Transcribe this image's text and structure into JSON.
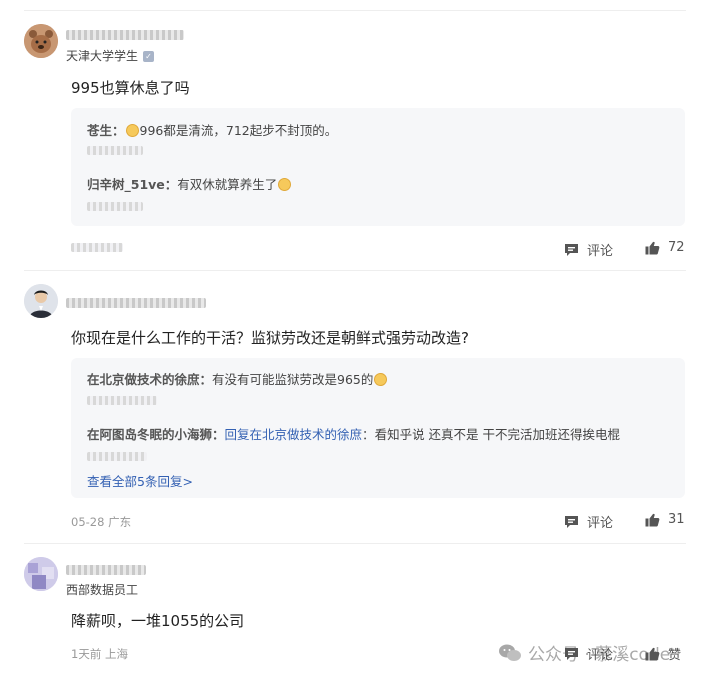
{
  "comments": [
    {
      "badge": "天津大学学生",
      "content": "995也算休息了吗",
      "replies": [
        {
          "name": "苍生",
          "text": "996都是清流，712起步不封顶的。"
        },
        {
          "name": "归辛树_51ve",
          "text": "有双休就算养生了"
        }
      ],
      "comment_label": "评论",
      "likes": "72"
    },
    {
      "content": "你现在是什么工作的干活？监狱劳改还是朝鲜式强劳动改造?",
      "replies": [
        {
          "name": "在北京做技术的徐庶",
          "text": "有没有可能监狱劳改是965的"
        },
        {
          "name": "在阿图岛冬眠的小海狮",
          "reply_to": "回复在北京做技术的徐庶",
          "text": "看知乎说 还真不是 干不完活加班还得挨电棍"
        }
      ],
      "view_all": "查看全部5条回复>",
      "date": "05-28 广东",
      "comment_label": "评论",
      "likes": "31"
    },
    {
      "badge": "西部数据员工",
      "content": "降薪呗，一堆1055的公司",
      "date": "1天前 上海",
      "comment_label": "评论",
      "likes_label": "赞"
    }
  ],
  "watermark": "公众号 · 慕溪code"
}
